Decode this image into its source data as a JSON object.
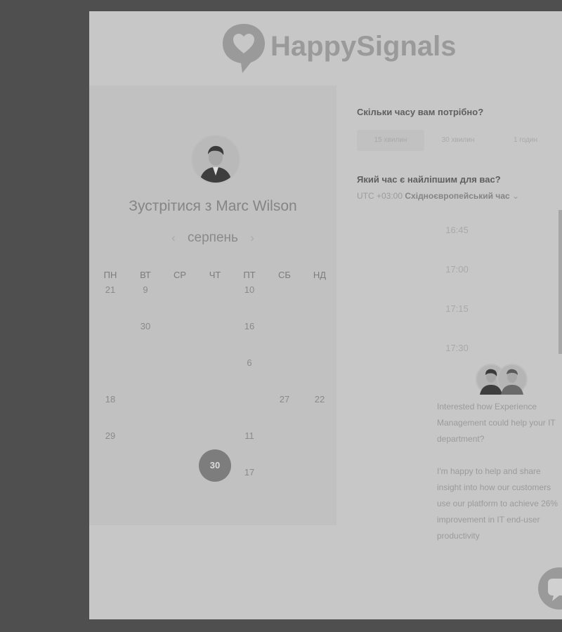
{
  "brand": {
    "name": "HappySignals"
  },
  "host": {
    "meet_title": "Зустрітися з Marc Wilson"
  },
  "calendar": {
    "month": "серпень",
    "weekdays": [
      "ПН",
      "ВТ",
      "СР",
      "ЧТ",
      "ПТ",
      "СБ",
      "НД"
    ],
    "selected_day": "30",
    "visible_days": [
      [
        "21",
        "9",
        "",
        "",
        "10",
        "",
        ""
      ],
      [
        "",
        "30",
        "",
        "",
        "16",
        "",
        ""
      ],
      [
        "",
        "",
        "",
        "",
        "6",
        "",
        ""
      ],
      [
        "18",
        "",
        "",
        "",
        "",
        "27",
        "22"
      ],
      [
        "29",
        "",
        "",
        "",
        "11",
        "",
        ""
      ],
      [
        "",
        "",
        "",
        "30",
        "17",
        "",
        ""
      ]
    ]
  },
  "duration": {
    "question": "Скільки часу вам потрібно?",
    "options": [
      "15 хвилин",
      "30 хвилин",
      "1 годин"
    ],
    "selected": "15 хвилин"
  },
  "time": {
    "question": "Який час є найліпшим для вас?",
    "tz_offset": "UTC +03:00",
    "tz_name": "Східноєвропейський час",
    "slots": [
      "16:45",
      "17:00",
      "17:15",
      "17:30"
    ]
  },
  "chat": {
    "message_1": "Interested how Experience Management could help your IT department?",
    "message_2": "I'm happy to help and share insight into how our customers use our platform to achieve 26% improvement in IT end-user productivity"
  },
  "colors": {
    "backdrop": "#4f4f4f",
    "modal": "#c7c7c7",
    "selected_day": "#7d7d7d"
  },
  "icons": [
    "heart-logo-icon",
    "chevron-left-icon",
    "chevron-right-icon",
    "chevron-down-icon",
    "chat-bubble-icon"
  ]
}
